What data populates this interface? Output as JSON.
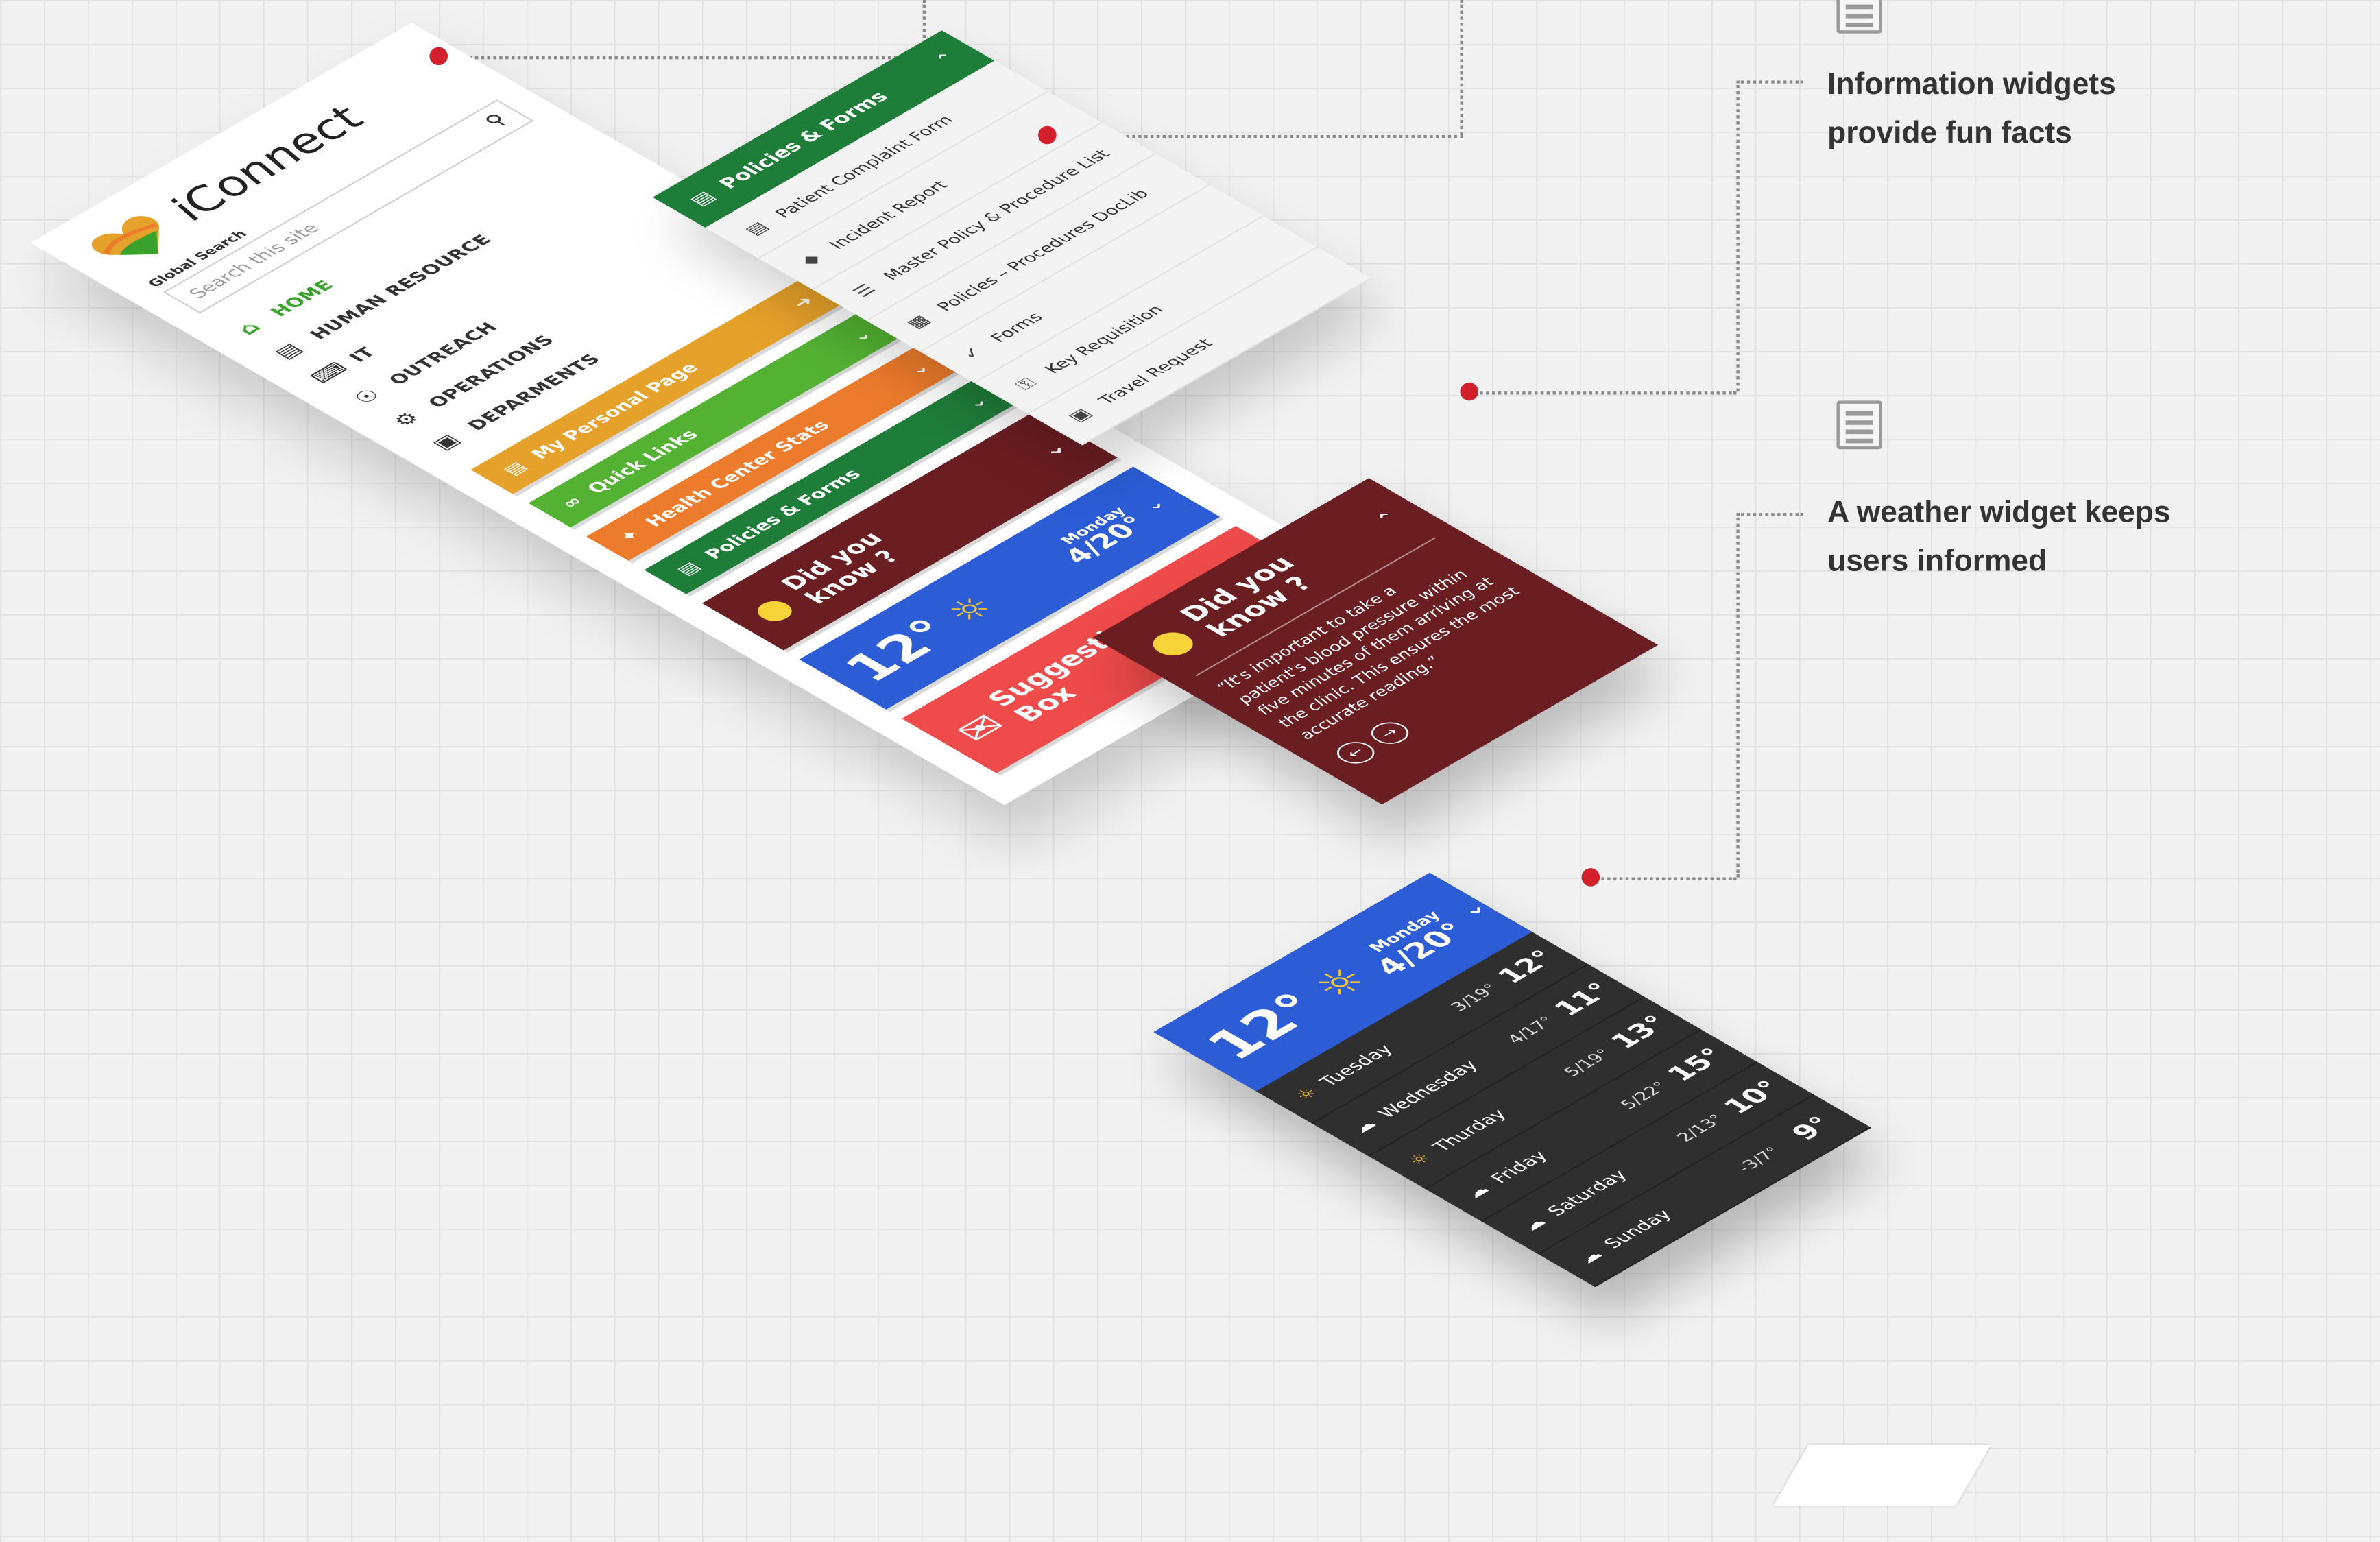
{
  "sidebar": {
    "logo_text": "iConnect",
    "search_label": "Global Search",
    "search_placeholder": "Search this site",
    "nav": [
      {
        "label": "HOME",
        "icon": "home-icon"
      },
      {
        "label": "HUMAN RESOURCE",
        "icon": "newspaper-icon"
      },
      {
        "label": "IT",
        "icon": "keyboard-icon"
      },
      {
        "label": "OUTREACH",
        "icon": "broadcast-icon"
      },
      {
        "label": "OPERATIONS",
        "icon": "gear-icon"
      },
      {
        "label": "DEPARMENTS",
        "icon": "briefcase-icon"
      }
    ],
    "tiles": {
      "personal": "My Personal Page",
      "quick": "Quick Links",
      "health": "Health Center Stats",
      "policies": "Policies & Forms",
      "dyk_line1": "Did you",
      "dyk_line2": "know ?",
      "weather_temp": "12°",
      "weather_day": "Monday",
      "weather_date": "4/20°",
      "suggestion_line1": "Suggestion",
      "suggestion_line2": "Box"
    }
  },
  "policies_menu": {
    "title": "Policies & Forms",
    "items": [
      "Patient Complaint Form",
      "Incident Report",
      "Master Policy & Procedure List",
      "Policies – Procedures DocLib",
      "Forms",
      "Key Requisition",
      "Travel Request"
    ]
  },
  "did_you_know": {
    "title_line1": "Did you",
    "title_line2": "know ?",
    "quote": "“It's important to take a patient's blood pressure within five minutes of them arriving at the clinic. This ensures the most accurate reading.”"
  },
  "weather": {
    "current_temp": "12°",
    "current_day": "Monday",
    "current_date": "4/20°",
    "forecast": [
      {
        "day": "Tuesday",
        "range": "3/19°",
        "temp": "12°"
      },
      {
        "day": "Wednesday",
        "range": "4/17°",
        "temp": "11°"
      },
      {
        "day": "Thurday",
        "range": "5/19°",
        "temp": "13°"
      },
      {
        "day": "Friday",
        "range": "5/22°",
        "temp": "15°"
      },
      {
        "day": "Saturday",
        "range": "2/13°",
        "temp": "10°"
      },
      {
        "day": "Sunday",
        "range": "-3/7°",
        "temp": "9°"
      }
    ]
  },
  "notes": {
    "info_line1": "Information widgets",
    "info_line2": "provide fun facts",
    "weather_line1": "A weather widget keeps",
    "weather_line2": "users informed"
  },
  "colors": {
    "accent_red": "#d21f2b",
    "green": "#1f7d3a",
    "maroon": "#6b1e22",
    "blue": "#2c5dd6"
  }
}
